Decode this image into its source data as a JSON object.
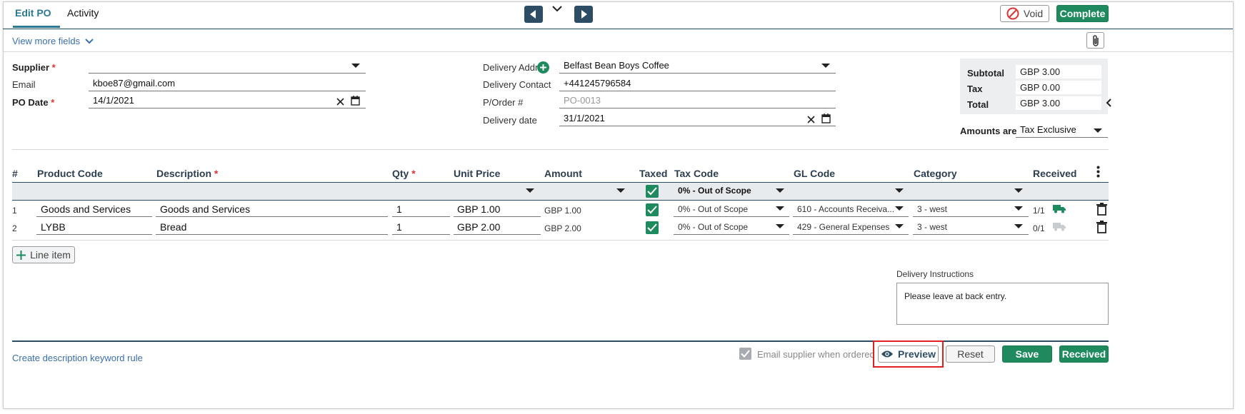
{
  "tabs": [
    {
      "label": "Edit PO"
    },
    {
      "label": "Activity"
    }
  ],
  "header": {
    "void_label": "Void",
    "complete_label": "Complete"
  },
  "view_more": "View more fields",
  "form": {
    "supplier_label": "Supplier",
    "supplier_value": "",
    "email_label": "Email",
    "email_value": "kboe87@gmail.com",
    "po_date_label": "PO Date",
    "po_date_value": "14/1/2021",
    "delivery_addr_label": "Delivery Addr",
    "delivery_addr_value": "Belfast Bean Boys Coffee",
    "delivery_contact_label": "Delivery Contact",
    "delivery_contact_value": "+441245796584",
    "porder_label": "P/Order #",
    "porder_placeholder": "PO-0013",
    "delivery_date_label": "Delivery date",
    "delivery_date_value": "31/1/2021"
  },
  "totals": {
    "subtotal_label": "Subtotal",
    "subtotal_value": "GBP  3.00",
    "tax_label": "Tax",
    "tax_value": "GBP  0.00",
    "total_label": "Total",
    "total_value": "GBP  3.00",
    "amounts_are_label": "Amounts are",
    "amounts_are_value": "Tax Exclusive"
  },
  "table": {
    "headers": {
      "num": "#",
      "product_code": "Product Code",
      "description": "Description",
      "qty": "Qty",
      "unit_price": "Unit Price",
      "amount": "Amount",
      "taxed": "Taxed",
      "tax_code": "Tax Code",
      "gl_code": "GL Code",
      "category": "Category",
      "received": "Received"
    },
    "filter_tax_code": "0% - Out of Scope",
    "rows": [
      {
        "num": "1",
        "product_code": "Goods and Services",
        "description": "Goods and Services",
        "qty": "1",
        "unit_price": "GBP  1.00",
        "amount": "GBP 1.00",
        "tax_code": "0% - Out of Scope",
        "gl_code": "610 - Accounts Receiva...",
        "category": "3 - west",
        "received": "1/1"
      },
      {
        "num": "2",
        "product_code": "LYBB",
        "description": "Bread",
        "qty": "1",
        "unit_price": "GBP  2.00",
        "amount": "GBP 2.00",
        "tax_code": "0% - Out of Scope",
        "gl_code": "429 - General Expenses",
        "category": "3 - west",
        "received": "0/1"
      }
    ],
    "line_item_label": "Line item"
  },
  "delivery_instructions": {
    "label": "Delivery Instructions",
    "value": "Please leave at back entry."
  },
  "footer": {
    "keyword_rule_link": "Create description keyword rule",
    "email_supplier_label": "Email supplier when ordered",
    "preview_label": "Preview",
    "reset_label": "Reset",
    "save_label": "Save",
    "received_label": "Received"
  },
  "colors": {
    "accent": "#2b7a94",
    "green": "#1e8a5e",
    "nav": "#2c4d63",
    "highlight": "#e02020"
  }
}
